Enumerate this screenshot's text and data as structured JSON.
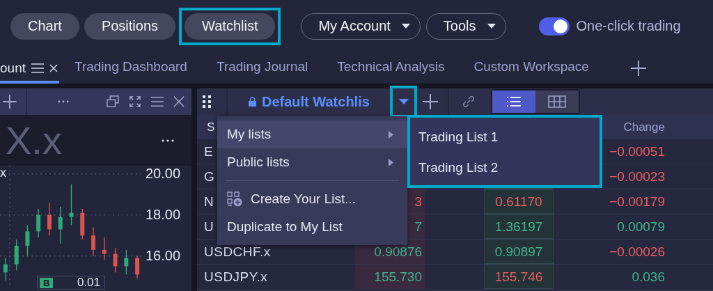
{
  "nav_buttons": [
    {
      "label": "Chart",
      "highlighted": false
    },
    {
      "label": "Positions",
      "highlighted": false
    },
    {
      "label": "Watchlist",
      "highlighted": true
    }
  ],
  "dropdowns": [
    {
      "label": "My Account"
    },
    {
      "label": "Tools"
    }
  ],
  "one_click_trading": {
    "label": "One-click trading",
    "on": true
  },
  "workspace_tabs": [
    {
      "label": "ount",
      "selected": true
    },
    {
      "label": "Trading Dashboard",
      "selected": false
    },
    {
      "label": "Trading Journal",
      "selected": false
    },
    {
      "label": "Technical Analysis",
      "selected": false
    },
    {
      "label": "Custom Workspace",
      "selected": false
    }
  ],
  "chart_panel": {
    "symbol": "x",
    "watermark": "X.x",
    "order_side": "B",
    "order_size": "0.01",
    "chart_data": {
      "type": "candlestick",
      "grid": true,
      "ylim": [
        14.6,
        20.4
      ],
      "yticks": [
        {
          "value": 20,
          "label": "20.00"
        },
        {
          "value": 18,
          "label": "18.00"
        },
        {
          "value": 16,
          "label": "16.00"
        }
      ],
      "ohlc": [
        [
          15.2,
          15.9,
          14.8,
          15.6
        ],
        [
          15.6,
          16.8,
          15.3,
          16.5
        ],
        [
          16.5,
          17.5,
          16.0,
          17.2
        ],
        [
          17.2,
          18.3,
          16.9,
          18.0
        ],
        [
          18.0,
          18.6,
          17.0,
          17.3
        ],
        [
          17.3,
          18.4,
          16.6,
          17.9
        ],
        [
          17.9,
          19.5,
          17.5,
          18.1
        ],
        [
          18.1,
          18.3,
          16.8,
          17.0
        ],
        [
          17.0,
          17.4,
          16.0,
          16.3
        ],
        [
          16.3,
          16.9,
          15.8,
          16.1
        ],
        [
          16.1,
          16.4,
          15.2,
          15.5
        ],
        [
          15.5,
          16.3,
          15.1,
          15.9
        ],
        [
          15.9,
          16.0,
          14.9,
          15.1
        ]
      ]
    }
  },
  "watchlist": {
    "title": "Default Watchlis",
    "dropdown_highlighted": true,
    "view_modes": [
      {
        "kind": "list",
        "selected": true
      },
      {
        "kind": "grid",
        "selected": false
      }
    ],
    "columns": [
      "S",
      "Change"
    ],
    "rows": [
      {
        "symbol": "E",
        "change": "−0.00051",
        "change_falling": true
      },
      {
        "symbol": "G",
        "change": "−0.00023",
        "change_falling": true
      },
      {
        "symbol": "N",
        "bid": "3",
        "bid_falling": true,
        "ask": "0.61170",
        "ask_falling": true,
        "change": "−0.00179",
        "change_falling": true
      },
      {
        "symbol": "U",
        "bid": "7",
        "bid_falling": false,
        "ask": "1.36197",
        "ask_falling": false,
        "change": "0.00079",
        "change_falling": false
      },
      {
        "symbol": "USDCHF.x",
        "bid": "0.90876",
        "bid_falling": false,
        "ask": "0.90897",
        "ask_falling": false,
        "change": "−0.00026",
        "change_falling": true
      },
      {
        "symbol": "USDJPY.x",
        "bid": "155.730",
        "bid_falling": false,
        "ask": "155.746",
        "ask_falling": true,
        "change": "0.036",
        "change_falling": false
      }
    ]
  },
  "list_menu": {
    "items": [
      {
        "kind": "submenu",
        "label": "My lists",
        "selected": true
      },
      {
        "kind": "submenu",
        "label": "Public lists",
        "selected": false
      },
      {
        "kind": "separator"
      },
      {
        "kind": "create",
        "label": "Create Your List...",
        "selected": false
      },
      {
        "kind": "action",
        "label": "Duplicate to My List",
        "selected": false
      }
    ]
  },
  "submenu": {
    "highlighted": true,
    "items": [
      {
        "label": "Trading List 1"
      },
      {
        "label": "Trading List 2"
      }
    ]
  }
}
